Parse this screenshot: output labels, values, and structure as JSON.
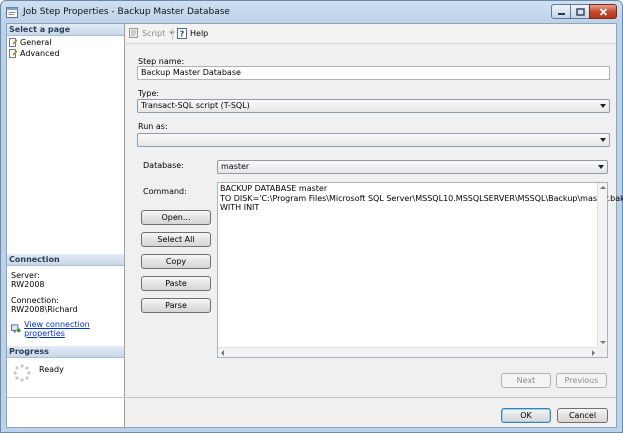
{
  "window": {
    "title": "Job Step Properties - Backup Master Database"
  },
  "left_panel": {
    "select_page_header": "Select a page",
    "pages": [
      {
        "label": "General"
      },
      {
        "label": "Advanced"
      }
    ],
    "connection_header": "Connection",
    "server_label": "Server:",
    "server_value": "RW2008",
    "connection_label": "Connection:",
    "connection_value": "RW2008\\Richard",
    "view_connection_link": "View connection properties",
    "progress_header": "Progress",
    "progress_status": "Ready"
  },
  "toolbar": {
    "script_label": "Script",
    "help_label": "Help"
  },
  "form": {
    "step_name_label": "Step name:",
    "step_name_value": "Backup Master Database",
    "type_label": "Type:",
    "type_value": "Transact-SQL script (T-SQL)",
    "run_as_label": "Run as:",
    "run_as_value": "",
    "database_label": "Database:",
    "database_value": "master",
    "command_label": "Command:",
    "command_text": "BACKUP DATABASE master\nTO DISK='C:\\Program Files\\Microsoft SQL Server\\MSSQL10.MSSQLSERVER\\MSSQL\\Backup\\master.bak'\nWITH INIT"
  },
  "buttons": {
    "open": "Open...",
    "select_all": "Select All",
    "copy": "Copy",
    "paste": "Paste",
    "parse": "Parse",
    "next": "Next",
    "previous": "Previous",
    "ok": "OK",
    "cancel": "Cancel"
  },
  "colors": {
    "title_bar": "#bcd2ea",
    "close_button": "#c2462b",
    "link": "#0033cc",
    "section_header": "#c8d8ea"
  }
}
